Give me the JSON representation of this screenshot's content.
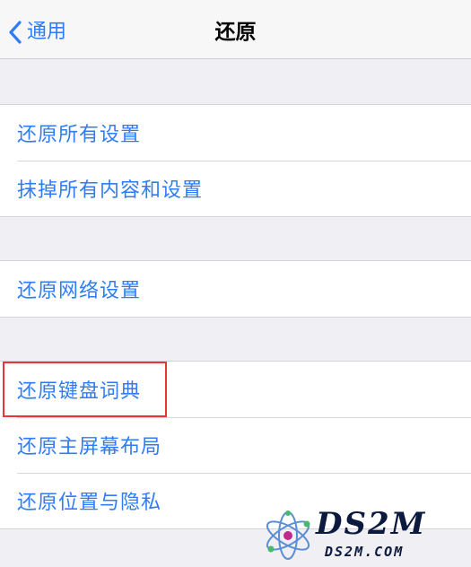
{
  "navbar": {
    "back_label": "通用",
    "title": "还原"
  },
  "groups": [
    {
      "items": [
        "还原所有设置",
        "抹掉所有内容和设置"
      ]
    },
    {
      "items": [
        "还原网络设置"
      ]
    },
    {
      "items": [
        "还原键盘词典",
        "还原主屏幕布局",
        "还原位置与隐私"
      ]
    }
  ],
  "watermark": {
    "main": "DS2M",
    "sub": "DS2M.COM"
  },
  "colors": {
    "accent": "#2f7cf6",
    "background": "#efeff4",
    "highlight": "#e8343a"
  }
}
